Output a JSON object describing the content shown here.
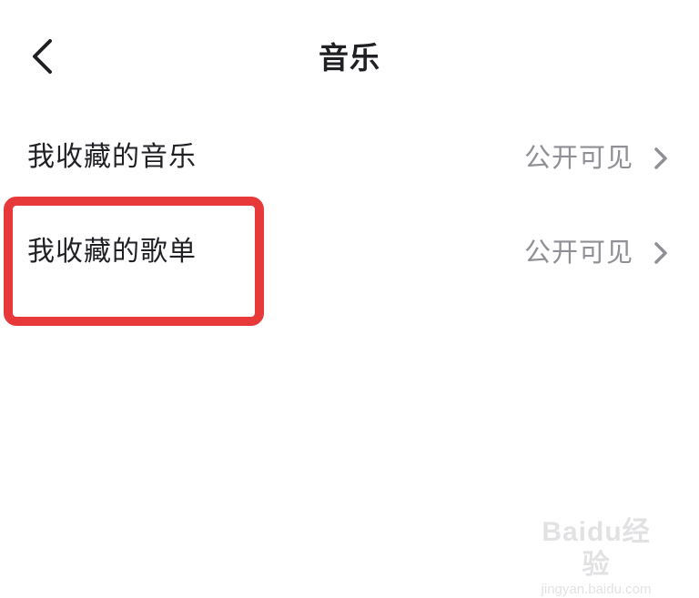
{
  "header": {
    "title": "音乐",
    "back_icon": "chevron-left-icon"
  },
  "rows": [
    {
      "label": "我收藏的音乐",
      "value": "公开可见",
      "icon": "chevron-right-icon"
    },
    {
      "label": "我收藏的歌单",
      "value": "公开可见",
      "icon": "chevron-right-icon"
    }
  ],
  "annotation": {
    "highlight_color": "#e8393a"
  },
  "watermark": {
    "logo_text": "Baidu经验",
    "url": "jingyan.baidu.com"
  },
  "colors": {
    "text_primary": "#1f1f24",
    "text_secondary": "#8f8f96",
    "background": "#ffffff"
  }
}
